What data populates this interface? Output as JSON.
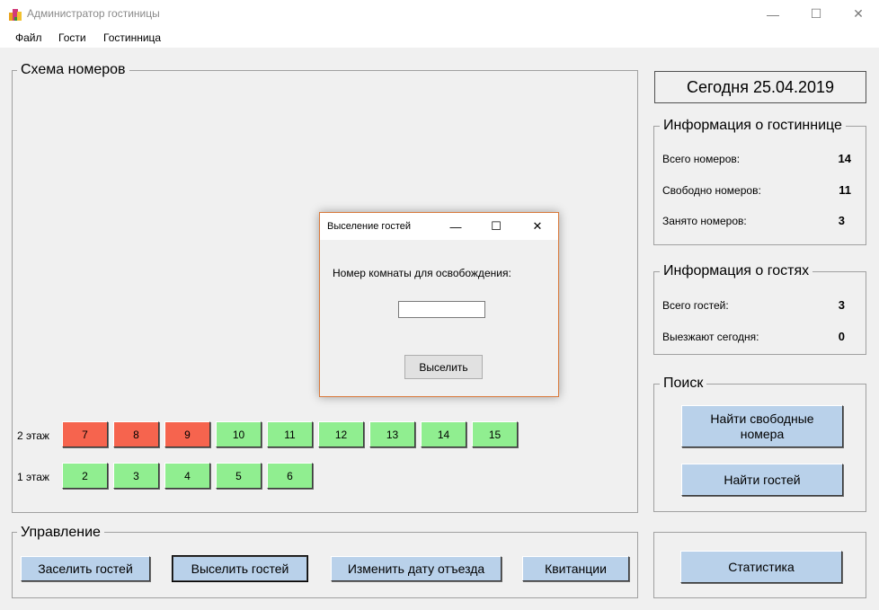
{
  "window": {
    "title": "Администратор гостиницы",
    "icon": "hotel-app-icon",
    "minimize_glyph": "—",
    "maximize_glyph": "☐",
    "close_glyph": "✕"
  },
  "menu": {
    "items": [
      "Файл",
      "Гости",
      "Гостинница"
    ]
  },
  "rooms_panel": {
    "title": "Схема номеров",
    "floor2_label": "2 этаж",
    "floor1_label": "1 этаж",
    "floor2_rooms": [
      {
        "number": "7",
        "status": "occupied"
      },
      {
        "number": "8",
        "status": "occupied"
      },
      {
        "number": "9",
        "status": "occupied"
      },
      {
        "number": "10",
        "status": "free"
      },
      {
        "number": "11",
        "status": "free"
      },
      {
        "number": "12",
        "status": "free"
      },
      {
        "number": "13",
        "status": "free"
      },
      {
        "number": "14",
        "status": "free"
      },
      {
        "number": "15",
        "status": "free"
      }
    ],
    "floor1_rooms": [
      {
        "number": "2",
        "status": "free"
      },
      {
        "number": "3",
        "status": "free"
      },
      {
        "number": "4",
        "status": "free"
      },
      {
        "number": "5",
        "status": "free"
      },
      {
        "number": "6",
        "status": "free"
      }
    ]
  },
  "management": {
    "title": "Управление",
    "checkin_label": "Заселить гостей",
    "checkout_label": "Выселить гостей",
    "change_date_label": "Изменить дату отъезда",
    "receipts_label": "Квитанции"
  },
  "date_display": "Сегодня 25.04.2019",
  "hotel_info": {
    "title": "Информация о гостиннице",
    "total_rooms_label": "Всего номеров:",
    "total_rooms_value": "14",
    "free_rooms_label": "Свободно номеров:",
    "free_rooms_value": "11",
    "occupied_rooms_label": "Занято номеров:",
    "occupied_rooms_value": "3"
  },
  "guest_info": {
    "title": "Информация о гостях",
    "total_guests_label": "Всего гостей:",
    "total_guests_value": "3",
    "leaving_today_label": "Выезжают сегодня:",
    "leaving_today_value": "0"
  },
  "search": {
    "title": "Поиск",
    "find_free_label": "Найти свободные номера",
    "find_guests_label": "Найти гостей"
  },
  "statistics_label": "Статистика",
  "dialog": {
    "title": "Выселение гостей",
    "prompt": "Номер комнаты для освобождения:",
    "input_value": "",
    "submit_label": "Выселить"
  },
  "colors": {
    "occupied": "#f6644e",
    "free": "#90ee90",
    "button": "#b9d1ea"
  }
}
